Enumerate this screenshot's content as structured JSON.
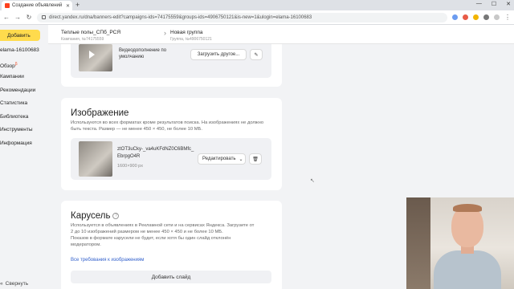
{
  "browser": {
    "tab_title": "Создание объявлений",
    "url": "direct.yandex.ru/dna/banners-edit?campaigns-ids=74175559&groups-ids=4906750121&is-new=1&ulogin=elama-16100683"
  },
  "sidebar": {
    "add_button": "Добавить",
    "items": [
      {
        "label": "elama-16100683"
      },
      {
        "label": "Обзор",
        "badge": "β"
      },
      {
        "label": "Кампании"
      },
      {
        "label": "Рекомендации"
      },
      {
        "label": "Статистика"
      },
      {
        "label": "Библиотека"
      },
      {
        "label": "Инструменты"
      },
      {
        "label": "Информация"
      }
    ],
    "collapse_label": "Свернуть"
  },
  "header": {
    "campaign_name": "Теплые полы_СПб_РСЯ",
    "campaign_id": "Кампания, №74175559",
    "group_name": "Новая группа",
    "group_id": "Группа, №4906750121"
  },
  "video_card": {
    "addition_label": "Видеодополнение по умолчанию",
    "upload_button": "Загрузить другое..."
  },
  "image_card": {
    "title": "Изображение",
    "description": "Используются во всех форматах кроме результатов поиска. На изображениях не должно быть текста. Размер — не менее 450 × 450, не более 10 МБ.",
    "file_name": "ztOT3uCky-_va4uKFdNZ0C6BMfc_EbrpgO4R",
    "dimensions": "1600×900 px",
    "edit_button": "Редактировать"
  },
  "carousel_card": {
    "title": "Карусель",
    "description_line1": "Используется в объявлениях в Рекламной сети и на сервисах Яндекса. Загрузите от",
    "description_line2": "2 до 10 изображений размером не менее 450 × 450 и не более 10 МБ.",
    "description_line3": "Показов в формате карусели не будет, если хотя бы один слайд отклонён",
    "description_line4": "модератором.",
    "requirements_link": "Все требования к изображениям",
    "add_slide_button": "Добавить слайд"
  },
  "colors": {
    "accent_yellow": "#ffdb4d",
    "link_blue": "#3361cc",
    "page_bg": "#f2f3f5"
  }
}
